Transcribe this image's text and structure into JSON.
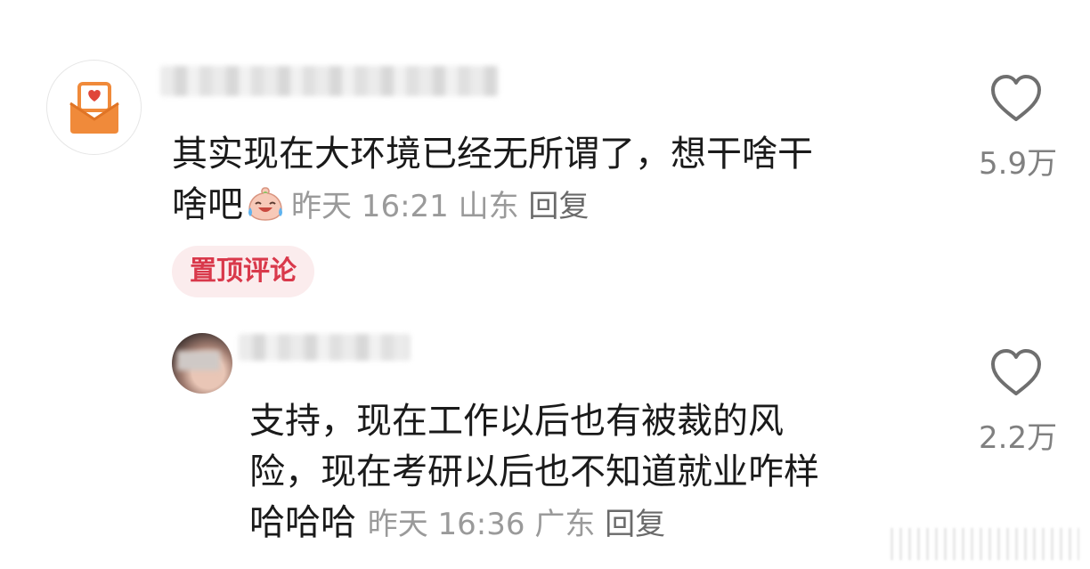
{
  "comments": [
    {
      "avatar_icon": "envelope-heart-icon",
      "text_line1": "其实现在大环境已经无所谓了，想干啥干",
      "text_line2": "啥吧",
      "emoji": "crying-laugh-emoji",
      "time": "昨天 16:21",
      "location": "山东",
      "reply_label": "回复",
      "pinned_label": "置顶评论",
      "likes": "5.9万"
    },
    {
      "text_line1": "支持，现在工作以后也有被裁的风",
      "text_line2": "险，现在考研以后也不知道就业咋样",
      "text_line3": "哈哈哈",
      "time": "昨天 16:36",
      "location": "广东",
      "reply_label": "回复",
      "likes": "2.2万"
    }
  ],
  "colors": {
    "pinned_text": "#d9394b",
    "pinned_bg": "#fbeced",
    "meta_text": "#9a9a9a",
    "avatar_envelope": "#f08a3a"
  }
}
